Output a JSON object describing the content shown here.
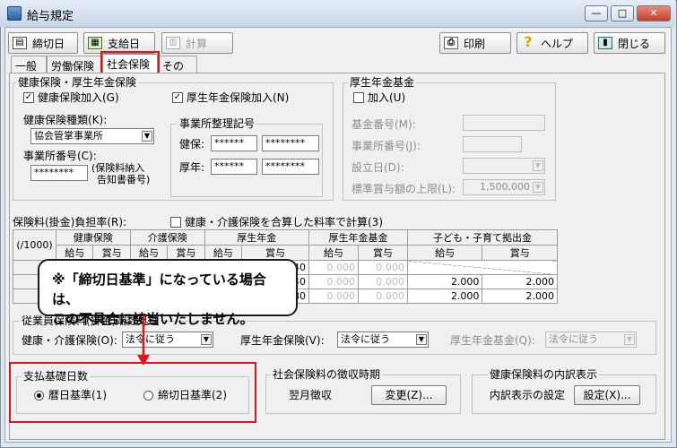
{
  "window": {
    "title": "給与規定",
    "min": "—",
    "max": "□",
    "close": "✕"
  },
  "toolbar": {
    "shimebi": "締切日",
    "shikyubi": "支給日",
    "keisan": "計算",
    "print": "印刷",
    "help": "ヘルプ",
    "close": "閉じる"
  },
  "tabs": [
    "一般",
    "労働保険",
    "社会保険",
    "その他"
  ],
  "kenko_kosei": {
    "group_title": "健康保険・厚生年金保険",
    "kenko_join": "健康保険加入(G)",
    "kosei_join": "厚生年金保険加入(N)",
    "type_label": "健康保険種類(K):",
    "type_value": "協会管掌事業所",
    "office_no_label": "事業所番号(C):",
    "office_no_value": "********",
    "office_no_note1": "(保険料納入",
    "office_no_note2": "告知書番号)",
    "seiri_title": "事業所整理記号",
    "kenpo_label": "健保:",
    "kenpo_val1": "******",
    "kenpo_val2": "********",
    "kosei_label": "厚年:",
    "kosei_val1": "******",
    "kosei_val2": "********"
  },
  "kikin": {
    "group_title": "厚生年金基金",
    "join": "加入(U)",
    "no_label": "基金番号(M):",
    "office_label": "事業所番号(J):",
    "date_label": "設立日(D):",
    "limit_label": "標準賞与額の上限(L):",
    "limit_value": "1,500,000"
  },
  "rates": {
    "label": "保険料(掛金)負担率(R):",
    "combined": "健康・介護保険を合算した料率で計算(3)",
    "unit": "(/1000)",
    "groups": [
      "健康保険",
      "介護保険",
      "厚生年金",
      "厚生年金基金",
      "子ども・子育て拠出金"
    ],
    "sub_kyuyo": "給与",
    "sub_shoyo": "賞与",
    "rows": [
      [
        "",
        "",
        "",
        "",
        "",
        "89.140",
        "0.000",
        "0.000",
        "",
        ""
      ],
      [
        "",
        "",
        "",
        "",
        "",
        "89.140",
        "0.000",
        "0.000",
        "2.000",
        "2.000"
      ],
      [
        "",
        "",
        "",
        "",
        "",
        "178.280",
        "0.000",
        "0.000",
        "2.000",
        "2.000"
      ]
    ]
  },
  "rounding": {
    "group_title": "従業員保険料(掛金)端数処理",
    "kenko_label": "健康・介護保険(O):",
    "kenko_value": "法令に従う",
    "kosei_label": "厚生年金保険(V):",
    "kosei_value": "法令に従う",
    "kikin_label": "厚生年金基金(Q):",
    "kikin_value": "法令に従う"
  },
  "payment_days": {
    "group_title": "支払基礎日数",
    "opt1": "暦日基準(1)",
    "opt2": "締切日基準(2)"
  },
  "collection": {
    "group_title": "社会保険料の徴収時期",
    "value": "翌月徴収",
    "button": "変更(Z)..."
  },
  "breakdown": {
    "group_title": "健康保険料の内訳表示",
    "label": "内訳表示の設定",
    "button": "設定(X)..."
  },
  "callout": {
    "line1": "※「締切日基準」になっている場合は、",
    "line2": "この不具合に該当いたしません。"
  },
  "colors": {
    "highlight": "#e2121e",
    "window_frame": "#7e8ea1"
  }
}
